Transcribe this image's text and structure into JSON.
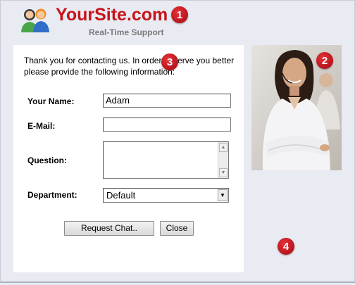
{
  "header": {
    "title": "YourSite.com",
    "subtitle": "Real-Time Support"
  },
  "badges": [
    "1",
    "2",
    "3",
    "4"
  ],
  "form": {
    "intro": "Thank you for contacting us. In order to serve you better please provide the following information:",
    "name_label": "Your Name:",
    "name_value": "Adam",
    "email_label": "E-Mail:",
    "email_value": "",
    "question_label": "Question:",
    "question_value": "",
    "department_label": "Department:",
    "department_value": "Default",
    "request_button": "Request Chat..",
    "close_button": "Close"
  },
  "colors": {
    "brand": "#c8141a",
    "badge": "#c8141a",
    "background": "#e9ebf3"
  }
}
